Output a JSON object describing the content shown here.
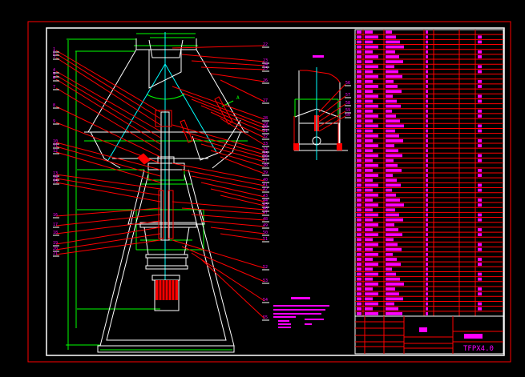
{
  "drawing": {
    "model_code": "TFPX4.0",
    "view_label": "A",
    "colors": {
      "background": "#000000",
      "frame": "#ff0000",
      "outline": "#ffffff",
      "dimension": "#00ff00",
      "centerline": "#00ffff",
      "leader": "#ff0000",
      "text": "#ff00ff"
    }
  },
  "callouts": {
    "left": [
      "1",
      "2",
      "3",
      "4",
      "5",
      "6",
      "7",
      "8",
      "9",
      "10",
      "11",
      "12",
      "13",
      "14",
      "15",
      "16",
      "17",
      "18",
      "19",
      "20",
      "21"
    ],
    "right": [
      "22",
      "23",
      "24",
      "25",
      "26",
      "27",
      "28",
      "29",
      "30",
      "31",
      "32",
      "33",
      "34",
      "35",
      "36",
      "37",
      "38",
      "39",
      "40",
      "41",
      "42",
      "43",
      "44",
      "45",
      "46",
      "47",
      "48",
      "49",
      "50",
      "51",
      "52",
      "53",
      "54",
      "55"
    ],
    "detail": [
      "56",
      "57",
      "58",
      "59",
      "60"
    ]
  },
  "parts_table": {
    "row_count": 58
  }
}
